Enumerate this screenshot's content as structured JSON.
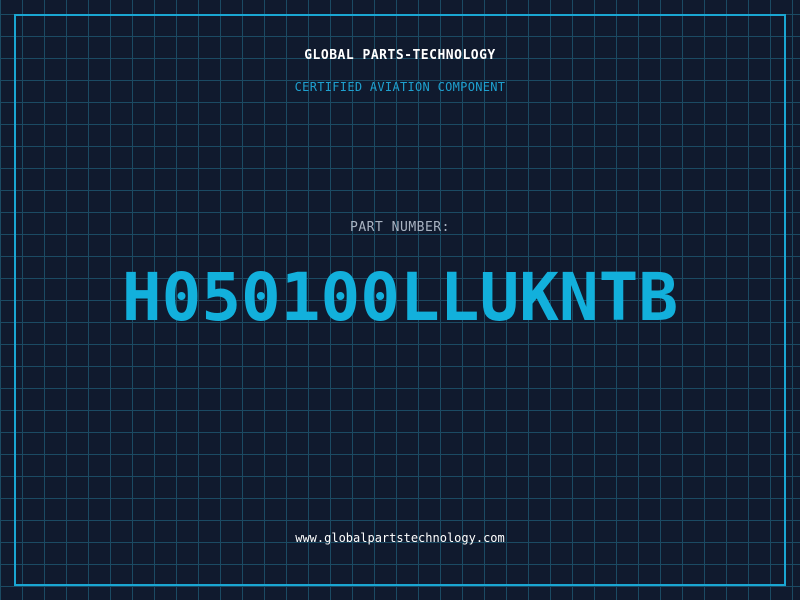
{
  "header": {
    "company": "GLOBAL PARTS-TECHNOLOGY",
    "subtitle": "CERTIFIED AVIATION COMPONENT"
  },
  "part": {
    "label": "PART NUMBER:",
    "number": "H050100LLUKNTB"
  },
  "footer": {
    "website": "www.globalpartstechnology.com"
  },
  "colors": {
    "background": "#101a2e",
    "grid": "#1b4a63",
    "frame": "#1aa6d2",
    "accent": "#12b0dc",
    "subtitle": "#1ea0cf",
    "label": "#a9b3c2",
    "text": "#ffffff"
  }
}
